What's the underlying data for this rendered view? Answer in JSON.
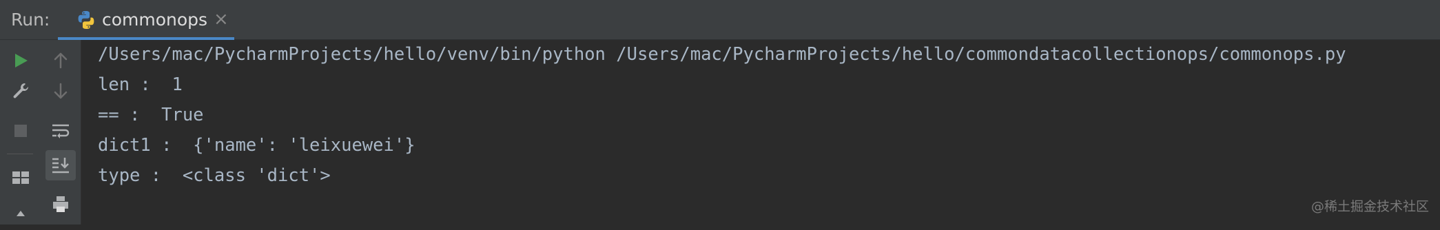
{
  "header": {
    "run_label": "Run:",
    "tab": {
      "label": "commonops",
      "icon": "python-icon",
      "close": "×"
    }
  },
  "toolbar_left": [
    "run-icon",
    "wrench-icon",
    "stop-icon",
    "layout-icon",
    "pin-icon"
  ],
  "toolbar_second": [
    "arrow-up-icon",
    "arrow-down-icon",
    "soft-wrap-icon",
    "scroll-to-end-icon",
    "print-icon"
  ],
  "console": {
    "lines": [
      "/Users/mac/PycharmProjects/hello/venv/bin/python /Users/mac/PycharmProjects/hello/commondatacollectionops/commonops.py",
      "len :  1",
      "== :  True",
      "dict1 :  {'name': 'leixuewei'}",
      "type :  <class 'dict'>"
    ]
  },
  "watermark": "@稀土掘金技术社区",
  "colors": {
    "header_bg": "#3c3f41",
    "console_bg": "#2b2b2b",
    "console_text": "#a9b7c6",
    "tab_underline": "#4a88c7",
    "run_green": "#499c54"
  }
}
